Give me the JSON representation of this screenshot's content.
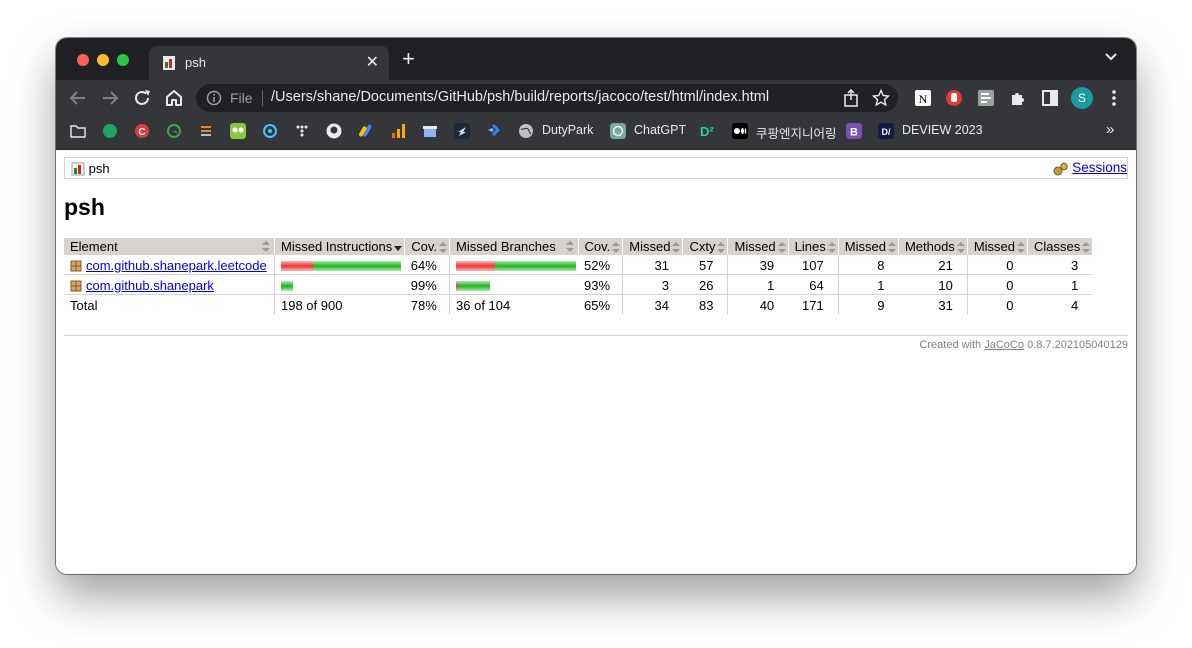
{
  "browser": {
    "tab_title": "psh",
    "url_scheme": "File",
    "url": "/Users/shane/Documents/GitHub/psh/build/reports/jacoco/test/html/index.html",
    "profile_initial": "S"
  },
  "bookmarks": [
    {
      "icon": "folder-icon"
    },
    {
      "icon": "green-circle-icon",
      "color": "#1fa463"
    },
    {
      "icon": "red-c-icon",
      "color": "#e03b3b"
    },
    {
      "icon": "green-clock-icon",
      "color": "#3fa34d"
    },
    {
      "icon": "sort-lines-icon",
      "color": "#e58b3a"
    },
    {
      "icon": "owl-icon",
      "color": "#8cc63f"
    },
    {
      "icon": "target-icon",
      "color": "#40c4ff"
    },
    {
      "icon": "dots-icon",
      "color": "#e8eaed"
    },
    {
      "icon": "github-icon",
      "color": "#e8eaed"
    },
    {
      "icon": "google-ads-icon",
      "color": "#fbbc04"
    },
    {
      "icon": "analytics-icon",
      "color": "#f9ab00"
    },
    {
      "icon": "store-icon",
      "color": "#8ab4f8"
    },
    {
      "icon": "zap-icon",
      "color": "#e8eaed"
    },
    {
      "icon": "jira-icon",
      "color": "#2684ff"
    },
    {
      "icon": "globe-icon",
      "label": "DutyPark"
    },
    {
      "icon": "chatgpt-icon",
      "label": "ChatGPT"
    },
    {
      "icon": "d2-icon",
      "color": "#1bd6a0"
    },
    {
      "icon": "medium-icon",
      "label": "쿠팡엔지니어링"
    },
    {
      "icon": "bootstrap-icon",
      "color": "#7952b3"
    },
    {
      "icon": "deview-icon",
      "label": "DEVIEW 2023"
    }
  ],
  "report": {
    "breadcrumb": "psh",
    "sessions_label": "Sessions",
    "title": "psh",
    "headers": [
      "Element",
      "Missed Instructions",
      "Cov.",
      "Missed Branches",
      "Cov.",
      "Missed",
      "Cxty",
      "Missed",
      "Lines",
      "Missed",
      "Methods",
      "Missed",
      "Classes"
    ],
    "rows": [
      {
        "element": "com.github.shanepark.leetcode",
        "instr_bar": {
          "missed": 222,
          "covered": 598
        },
        "instr_cov": "64%",
        "branch_bar": {
          "missed": 34,
          "covered": 70
        },
        "branch_cov": "52%",
        "cxty_missed": "31",
        "cxty": "57",
        "lines_missed": "39",
        "lines": "107",
        "methods_missed": "8",
        "methods": "21",
        "classes_missed": "0",
        "classes": "3"
      },
      {
        "element": "com.github.shanepark",
        "instr_bar": {
          "missed": 1,
          "covered": 79
        },
        "instr_cov": "99%",
        "branch_bar": {
          "missed": 2,
          "covered": 28
        },
        "branch_cov": "93%",
        "cxty_missed": "3",
        "cxty": "26",
        "lines_missed": "1",
        "lines": "64",
        "methods_missed": "1",
        "methods": "10",
        "classes_missed": "0",
        "classes": "1"
      }
    ],
    "total": {
      "label": "Total",
      "instr": "198 of 900",
      "instr_cov": "78%",
      "branch": "36 of 104",
      "branch_cov": "65%",
      "cxty_missed": "34",
      "cxty": "83",
      "lines_missed": "40",
      "lines": "171",
      "methods_missed": "9",
      "methods": "31",
      "classes_missed": "0",
      "classes": "4"
    },
    "footer_prefix": "Created with",
    "footer_link": "JaCoCo",
    "footer_version": "0.8.7.202105040129"
  }
}
